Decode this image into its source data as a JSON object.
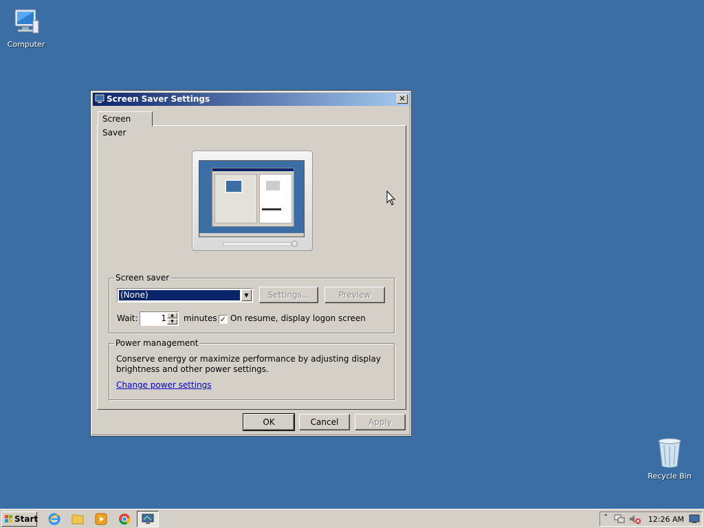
{
  "desktop": {
    "icons": [
      {
        "label": "Computer",
        "icon": "computer-icon"
      },
      {
        "label": "Recycle Bin",
        "icon": "recycle-bin-icon"
      }
    ]
  },
  "dialog": {
    "title": "Screen Saver Settings",
    "tab": "Screen Saver",
    "screen_saver_group": {
      "legend": "Screen saver",
      "selected": "(None)",
      "settings_button": "Settings...",
      "preview_button": "Preview",
      "wait_label": "Wait:",
      "wait_value": "1",
      "minutes_label": "minutes",
      "resume_checkbox_label": "On resume, display logon screen",
      "resume_checked": true
    },
    "power_group": {
      "legend": "Power management",
      "description_line1": "Conserve energy or maximize performance by adjusting display",
      "description_line2": "brightness and other power settings.",
      "link": "Change power settings"
    },
    "buttons": {
      "ok": "OK",
      "cancel": "Cancel",
      "apply": "Apply"
    }
  },
  "taskbar": {
    "start_label": "Start",
    "quick_launch": [
      "ie-icon",
      "explorer-icon",
      "media-player-icon",
      "chrome-icon"
    ],
    "clock": "12:26 AM"
  },
  "colors": {
    "desktop_bg": "#3a6ea5",
    "title_start": "#0a246a",
    "title_end": "#a6caf0",
    "face": "#d4d0c8"
  }
}
